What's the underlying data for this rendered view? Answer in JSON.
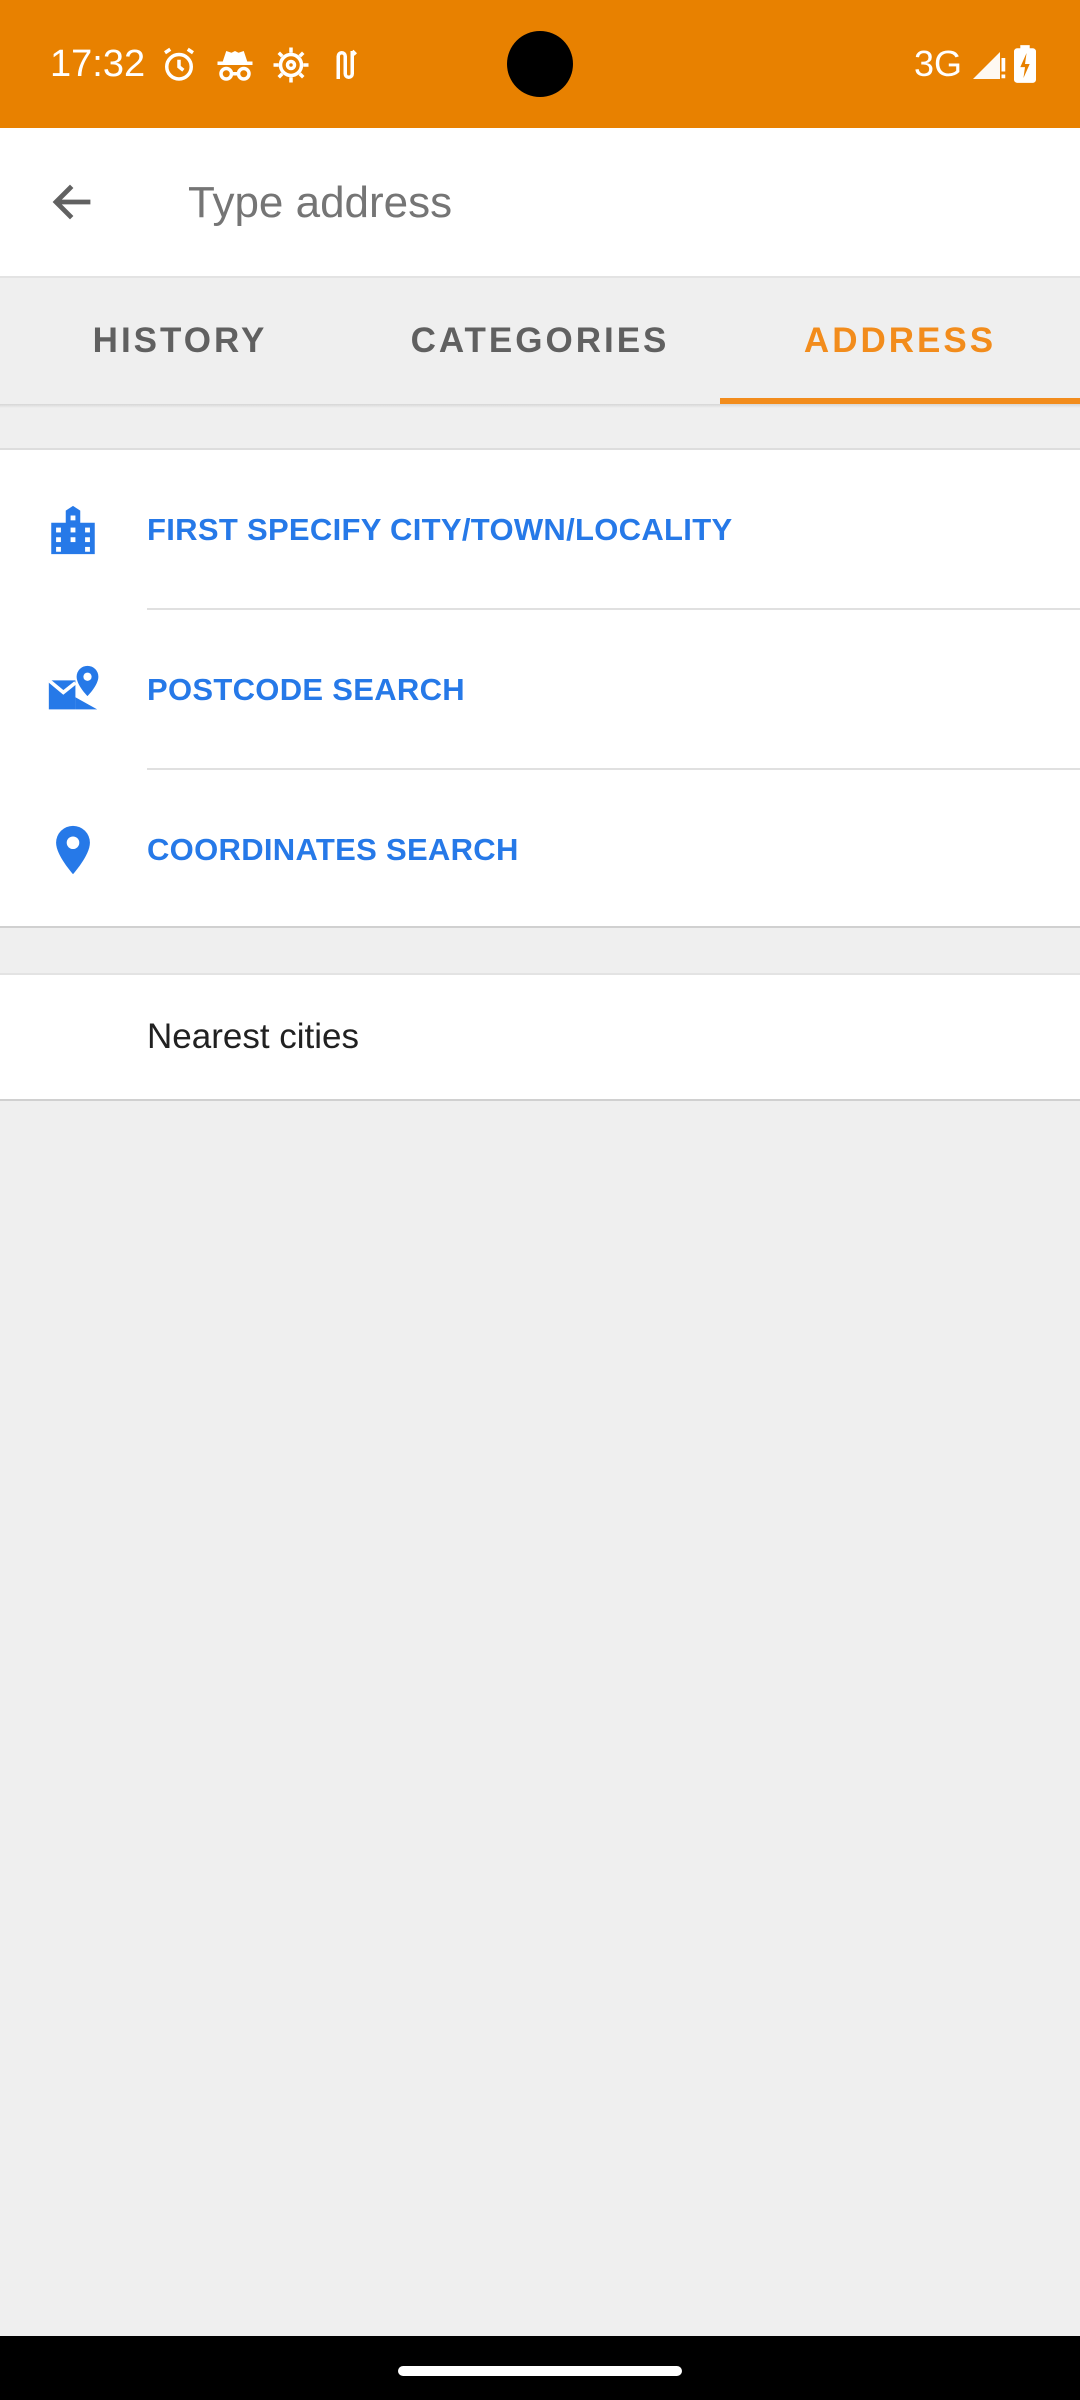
{
  "status_bar": {
    "time": "17:32",
    "network": "3G",
    "icons": [
      "alarm-icon",
      "incognito-icon",
      "settings-gear-icon",
      "gesture-icon",
      "signal-icon",
      "battery-charging-icon"
    ],
    "background_color": "#e88100"
  },
  "search": {
    "placeholder": "Type address",
    "value": ""
  },
  "tabs": [
    {
      "label": "HISTORY",
      "active": false
    },
    {
      "label": "CATEGORIES",
      "active": false
    },
    {
      "label": "ADDRESS",
      "active": true
    }
  ],
  "accent_color": "#f28c1c",
  "link_color": "#2679e8",
  "address_options": [
    {
      "label": "FIRST SPECIFY CITY/TOWN/LOCALITY",
      "icon": "city-buildings-icon"
    },
    {
      "label": "POSTCODE SEARCH",
      "icon": "map-pin-envelope-icon"
    },
    {
      "label": "COORDINATES SEARCH",
      "icon": "location-pin-icon"
    }
  ],
  "nearest_cities": {
    "label": "Nearest cities"
  }
}
